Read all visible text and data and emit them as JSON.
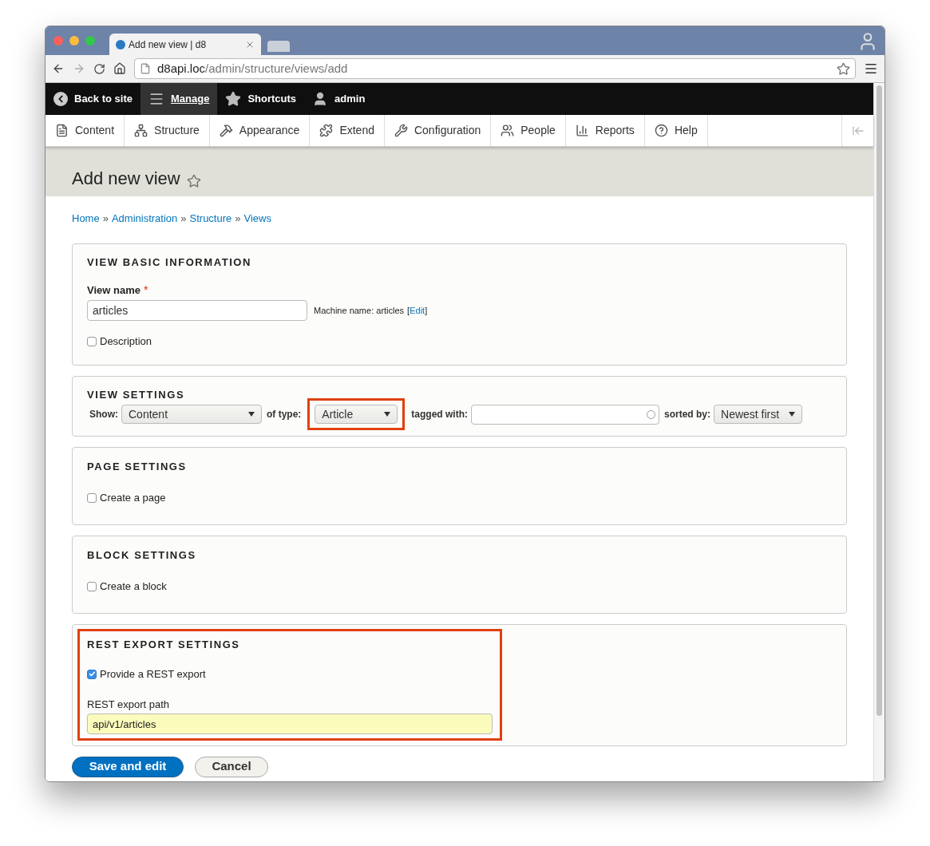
{
  "browser": {
    "tab_title": "Add new view | d8",
    "url_host": "d8api.loc",
    "url_path": "/admin/structure/views/add"
  },
  "toolbar": [
    {
      "label": "Back to site",
      "kind": "back",
      "selected": false
    },
    {
      "label": "Manage",
      "kind": "manage",
      "selected": true
    },
    {
      "label": "Shortcuts",
      "kind": "shortcuts",
      "selected": false
    },
    {
      "label": "admin",
      "kind": "user",
      "selected": false
    }
  ],
  "admin_menu": [
    {
      "label": "Content",
      "kind": "content"
    },
    {
      "label": "Structure",
      "kind": "structure"
    },
    {
      "label": "Appearance",
      "kind": "appearance"
    },
    {
      "label": "Extend",
      "kind": "extend"
    },
    {
      "label": "Configuration",
      "kind": "configuration"
    },
    {
      "label": "People",
      "kind": "people"
    },
    {
      "label": "Reports",
      "kind": "reports"
    },
    {
      "label": "Help",
      "kind": "help"
    }
  ],
  "page_title": "Add new view",
  "breadcrumb": [
    {
      "label": "Home"
    },
    {
      "separator": "»",
      "label": "Administration"
    },
    {
      "separator": "»",
      "label": "Structure"
    },
    {
      "separator": "»",
      "label": "Views"
    }
  ],
  "basic_info": {
    "title": "VIEW BASIC INFORMATION",
    "name_label": "View name",
    "required_mark": "*",
    "name_value": "articles",
    "machine_name": "Machine name: articles",
    "edit_open": "[",
    "edit_link": "Edit",
    "edit_close": "]",
    "description": {
      "label": "Description",
      "checked": false
    }
  },
  "view_settings": {
    "title": "VIEW SETTINGS",
    "show_label": "Show:",
    "show_value": "Content",
    "type_label": "of type:",
    "type_value": "Article",
    "type_highlighted": true,
    "tagged_label": "tagged with:",
    "sorted_label": "sorted by:",
    "sorted_value": "Newest first"
  },
  "page_settings": {
    "title": "PAGE SETTINGS",
    "checkbox": {
      "label": "Create a page",
      "checked": false
    }
  },
  "block_settings": {
    "title": "BLOCK SETTINGS",
    "checkbox": {
      "label": "Create a block",
      "checked": false
    }
  },
  "rest_export": {
    "title": "REST EXPORT SETTINGS",
    "highlighted": true,
    "checkbox": {
      "label": "Provide a REST export",
      "checked": true
    },
    "path_label": "REST export path",
    "path_value": "api/v1/articles"
  },
  "buttons": [
    {
      "label": "Save and edit",
      "kind": "primary"
    },
    {
      "label": "Cancel",
      "kind": "secondary"
    }
  ]
}
